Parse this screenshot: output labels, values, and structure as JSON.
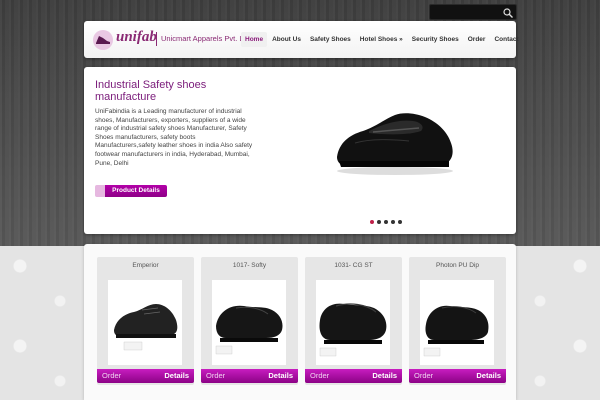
{
  "search": {
    "placeholder": ""
  },
  "header": {
    "brand": "unifab",
    "company": "Unicmart Apparels Pvt. Ltd"
  },
  "nav": {
    "items": [
      {
        "label": "Home"
      },
      {
        "label": "About Us"
      },
      {
        "label": "Safety Shoes"
      },
      {
        "label": "Hotel Shoes »"
      },
      {
        "label": "Security Shoes"
      },
      {
        "label": "Order"
      },
      {
        "label": "Contact"
      }
    ]
  },
  "slider": {
    "title": "Industrial Safety shoes manufacture",
    "text": "UniFabindia is a Leading manufacturer of industrial shoes, Manufacturers, exporters, suppliers of a wide range of industrial safety shoes Manufacturer, Safety Shoes manufacturers, safety boots Manufacturers,safety leather shoes in india Also safety footwear manufacturers in india, Hyderabad, Mumbai, Pune, Delhi",
    "button": "Product Details",
    "slides": 5,
    "active_slide": 1
  },
  "products": [
    {
      "name": "Emperior",
      "order": "Order",
      "details": "Details"
    },
    {
      "name": "1017- Softy",
      "order": "Order",
      "details": "Details"
    },
    {
      "name": "1031- CG ST",
      "order": "Order",
      "details": "Details"
    },
    {
      "name": "Photon PU Dip",
      "order": "Order",
      "details": "Details"
    }
  ],
  "colors": {
    "accent": "#8a1a7a",
    "button": "#b200a8",
    "header_band": "#4a4a4a"
  }
}
